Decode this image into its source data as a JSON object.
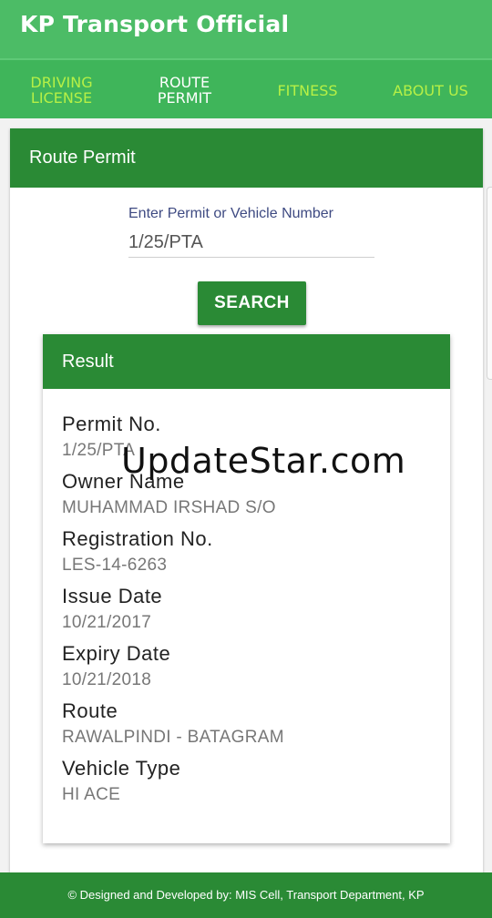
{
  "app": {
    "title": "KP Transport Official"
  },
  "tabs": [
    {
      "line1": "DRIVING",
      "line2": "LICENSE",
      "active": false
    },
    {
      "line1": "ROUTE",
      "line2": "PERMIT",
      "active": true
    },
    {
      "line1": "FITNESS",
      "line2": "",
      "active": false
    },
    {
      "line1": "ABOUT US",
      "line2": "",
      "active": false
    }
  ],
  "card": {
    "title": "Route Permit"
  },
  "search": {
    "label": "Enter Permit or Vehicle Number",
    "value": "1/25/PTA",
    "button_label": "SEARCH"
  },
  "result": {
    "title": "Result",
    "rows": [
      {
        "label": "Permit No.",
        "value": "1/25/PTA"
      },
      {
        "label": "Owner Name",
        "value": "MUHAMMAD IRSHAD S/O"
      },
      {
        "label": "Registration No.",
        "value": "LES-14-6263"
      },
      {
        "label": "Issue Date",
        "value": "10/21/2017"
      },
      {
        "label": "Expiry Date",
        "value": "10/21/2018"
      },
      {
        "label": "Route",
        "value": "RAWALPINDI - BATAGRAM"
      },
      {
        "label": "Vehicle Type",
        "value": "HI ACE"
      }
    ]
  },
  "watermark": "UpdateStar.com",
  "footer": "© Designed and Developed by: MIS Cell, Transport Department, KP",
  "colors": {
    "appbar": "#4cbc66",
    "tabbar": "#3fb55a",
    "tab_inactive_text": "#b6f046",
    "primary_dark": "#2a8a35"
  }
}
